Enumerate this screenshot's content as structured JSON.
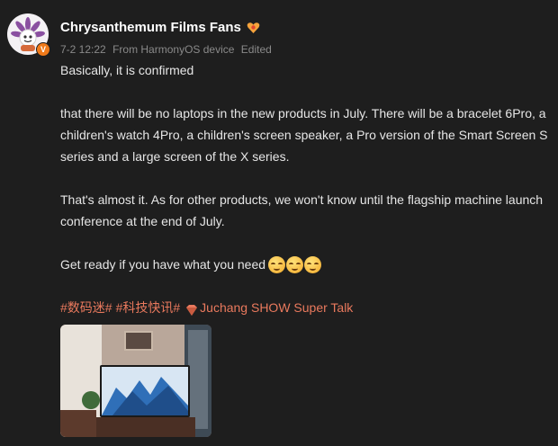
{
  "post": {
    "username": "Chrysanthemum Films Fans",
    "date": "7-2 12:22",
    "source": "From HarmonyOS device",
    "edited": "Edited",
    "paragraphs": [
      "Basically, it is confirmed",
      "that there will be no laptops in the new products in July. There will be a bracelet 6Pro, a children's watch 4Pro, a children's screen speaker, a Pro version of the Smart Screen S series and a large screen of the X series.",
      "That's almost it. As for other products, we won't know until the flagship machine launch conference at the end of July.",
      "Get ready if you have what you need"
    ],
    "emoji_count": 3,
    "tags": [
      "#数码迷#",
      "#科技快讯#"
    ],
    "super_topic": "Juchang SHOW Super Talk"
  },
  "colors": {
    "background": "#1e1e1e",
    "text": "#e6e6e6",
    "meta": "#8a8a8a",
    "tag": "#e9795d",
    "verified_badge": "#f07a1a"
  },
  "icons": {
    "verified": "verified-badge-icon",
    "fan": "fan-badge-icon",
    "super_topic": "super-topic-icon",
    "emoji": "smirk-emoji-icon"
  }
}
